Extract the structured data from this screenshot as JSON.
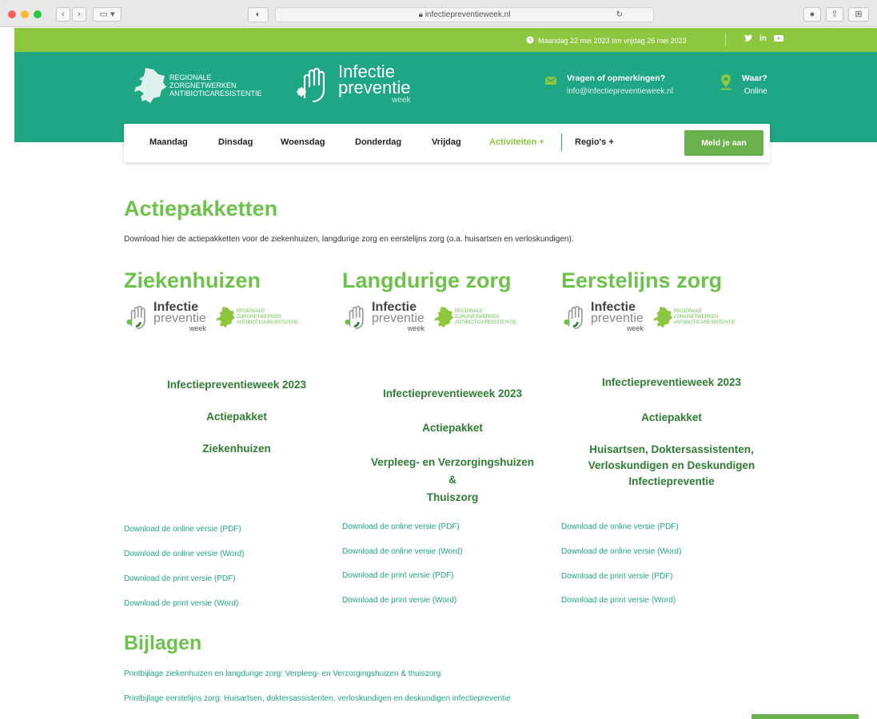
{
  "browser": {
    "url": "infectiepreventieweek.nl",
    "traffic_colors": [
      "#ff5f57",
      "#febc2e",
      "#28c840"
    ]
  },
  "topbar": {
    "date": "Maandag 22 mei 2023 t/m vrijdag 26 mei 2023",
    "social": [
      "twitter-icon",
      "linkedin-icon",
      "youtube-icon"
    ],
    "social_text": {
      "linkedin": "in"
    }
  },
  "header": {
    "logo_rz": [
      "REGIONALE",
      "ZORGNETWERKEN",
      "ANTIBIOTICARESISTENTIE"
    ],
    "logo_ip": {
      "line1": "Infectie",
      "line2": "preventie",
      "line3": "week"
    },
    "contact_title": "Vragen of opmerkingen?",
    "contact_email": "info@infectiepreventieweek.nl",
    "where_title": "Waar?",
    "where_value": "Online"
  },
  "nav": {
    "items": [
      "Maandag",
      "Dinsdag",
      "Woensdag",
      "Donderdag",
      "Vrijdag",
      "Activiteiten +",
      "Regio's +"
    ],
    "cta": "Meld je aan"
  },
  "main": {
    "title": "Actiepakketten",
    "intro": "Download hier de actiepakketten voor de ziekenhuizen, langdurige zorg en eerstelijns zorg (o.a. huisartsen en verloskundigen).",
    "columns": [
      {
        "title": "Ziekenhuizen",
        "pack": [
          "Infectiepreventieweek 2023",
          "Actiepakket",
          "Ziekenhuizen"
        ],
        "downloads": [
          "Download de online versie (PDF)",
          "Download de online versie (Word)",
          "Download de print versie (PDF)",
          "Download de print versie (Word)"
        ]
      },
      {
        "title": "Langdurige zorg",
        "pack": [
          "Infectiepreventieweek 2023",
          "Actiepakket",
          "Verpleeg- en Verzorgingshuizen",
          "&",
          "Thuiszorg"
        ],
        "downloads": [
          "Download de online versie (PDF)",
          "Download de online versie (Word)",
          "Download de print versie (PDF)",
          "Download de print versie (Word)"
        ]
      },
      {
        "title": "Eerstelijns zorg",
        "pack": [
          "Infectiepreventieweek 2023",
          "Actiepakket",
          "Huisartsen, Doktersassistenten,",
          "Verloskundigen en Deskundigen",
          "Infectiepreventie"
        ],
        "downloads": [
          "Download de online versie (PDF)",
          "Download de online versie (Word)",
          "Download de print versie (PDF)",
          "Download de print versie (Word)"
        ]
      }
    ],
    "bijlagen_title": "Bijlagen",
    "bijlagen": [
      "Printbijlage ziekenhuizen en langdurige zorg: Verpleeg- en Verzorgingshuizen & thuiszorg",
      "Printbijlage eerstelijns zorg: Huisartsen, doktersassistenten, verloskundigen en deskundigen infectiepreventie"
    ]
  },
  "colors": {
    "green": "#8dc63f",
    "teal": "#1fa685",
    "title_green": "#6cc24a",
    "pack_green": "#2e7d32"
  }
}
